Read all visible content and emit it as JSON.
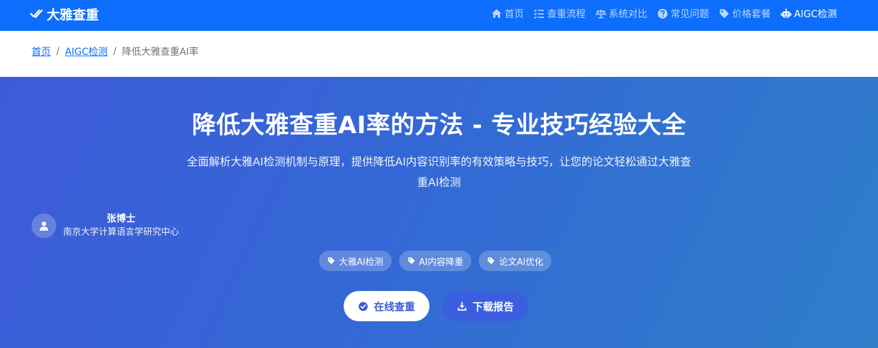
{
  "nav": {
    "brand": "大雅查重",
    "links": [
      {
        "label": "首页",
        "icon": "home-icon"
      },
      {
        "label": "查重流程",
        "icon": "list-check-icon"
      },
      {
        "label": "系统对比",
        "icon": "balance-scale-icon"
      },
      {
        "label": "常见问题",
        "icon": "question-circle-icon"
      },
      {
        "label": "价格套餐",
        "icon": "tag-icon"
      },
      {
        "label": "AIGC检测",
        "icon": "robot-icon",
        "active": true
      }
    ]
  },
  "breadcrumb": {
    "items": [
      "首页",
      "AIGC检测"
    ],
    "current": "降低大雅查重AI率",
    "separator": "/"
  },
  "hero": {
    "title": "降低大雅查重AI率的方法 - 专业技巧经验大全",
    "subtitle": "全面解析大雅AI检测机制与原理，提供降低AI内容识别率的有效策略与技巧，让您的论文轻松通过大雅查重AI检测",
    "author": {
      "name": "张博士",
      "org": "南京大学计算语言学研究中心"
    },
    "tags": [
      "大雅AI检测",
      "AI内容降重",
      "论文AI优化"
    ],
    "primary_button": "在线查重",
    "secondary_button": "下载报告"
  },
  "colors": {
    "nav_bg": "#0d6efd",
    "hero_gradient_start": "#3d5bd8",
    "hero_gradient_end": "#2f7ec9",
    "link": "#0d6efd"
  }
}
